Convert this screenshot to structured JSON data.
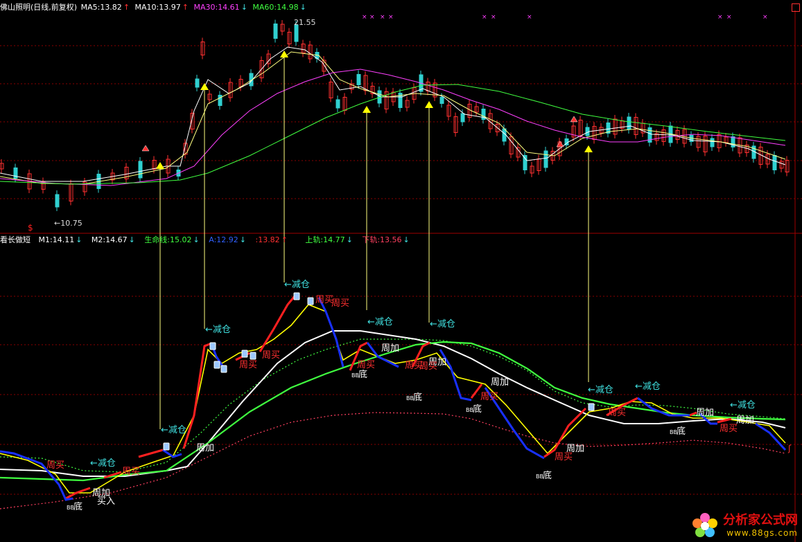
{
  "header1": {
    "title": "佛山照明(日线,前复权)",
    "items": [
      {
        "label": "MA5:13.82",
        "arrow": "↑",
        "color": "#ffffff",
        "arrow_color": "#ff3030"
      },
      {
        "label": "MA10:13.97",
        "arrow": "↑",
        "color": "#ffffff",
        "arrow_color": "#ff3030"
      },
      {
        "label": "MA30:14.61",
        "arrow": "↓",
        "color": "#ff40ff",
        "arrow_color": "#40e0e0"
      },
      {
        "label": "MA60:14.98",
        "arrow": "↓",
        "color": "#40ff40",
        "arrow_color": "#40e0e0"
      }
    ]
  },
  "header2": {
    "title": "看长做短",
    "items": [
      {
        "label": "M1:14.11",
        "arrow": "↓",
        "color": "#ffffff",
        "arrow_color": "#40e0e0"
      },
      {
        "label": "M2:14.67",
        "arrow": "↓",
        "color": "#ffffff",
        "arrow_color": "#40e0e0"
      },
      {
        "label": "生命线:15.02",
        "arrow": "↓",
        "color": "#40ff40",
        "arrow_color": "#40e0e0"
      },
      {
        "label": "A:12.92",
        "arrow": "↓",
        "color": "#3060ff",
        "arrow_color": "#40e0e0"
      },
      {
        "label": ":13.82",
        "arrow": "↑",
        "color": "#ff3030",
        "arrow_color": "#ff3030"
      },
      {
        "label": "上轨:14.77",
        "arrow": "↓",
        "color": "#40ff40",
        "arrow_color": "#40e0e0"
      },
      {
        "label": "下轨:13.56",
        "arrow": "↓",
        "color": "#ff4060",
        "arrow_color": "#40e0e0"
      }
    ]
  },
  "annotations": {
    "price_high": "21.55",
    "price_low": "←10.75",
    "reduce": "←减仓",
    "week_add": "周加",
    "week_buy": "周买",
    "bottom": "底",
    "buy": "买入",
    "dollar": "$"
  },
  "watermark": {
    "title": "分析家公式网",
    "url": "www.88gs.com"
  },
  "colors": {
    "grid": "#8b0000",
    "up": "#ff3030",
    "down": "#30d0d0",
    "ma5": "#ffffff",
    "ma10": "#ffff80",
    "ma30": "#ff40ff",
    "ma60": "#40ff40",
    "yellow": "#ffff00",
    "red": "#ff2020",
    "blue": "#1830ff",
    "cyan_text": "#40e0e0"
  }
}
